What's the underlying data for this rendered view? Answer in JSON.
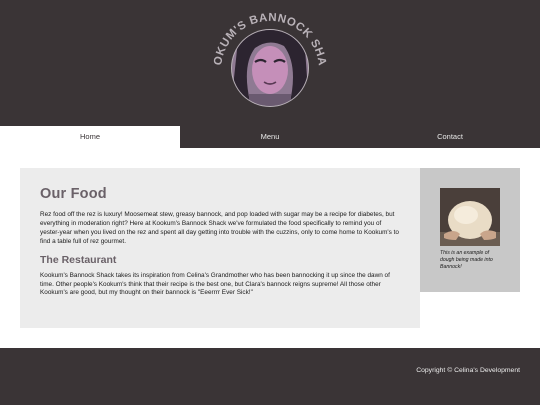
{
  "header": {
    "logo_text": "KOOKUM'S BANNOCK SHACK",
    "logo_icon": "kookum-portrait-logo"
  },
  "nav": {
    "items": [
      {
        "label": "Home",
        "active": true
      },
      {
        "label": "Menu",
        "active": false
      },
      {
        "label": "Contact",
        "active": false
      }
    ]
  },
  "main": {
    "title": "Our Food",
    "intro": "Rez food off the rez is luxury! Moosemeat stew, greasy bannock, and pop loaded with sugar may be a recipe for diabetes, but everything in moderation right? Here at Kookum's Bannock Shack we've formulated the food specifically to remind you of yester-year when you lived on the rez and spent all day getting into trouble with the cuzzins, only to come home to Kookum's to find a table full of rez gourmet.",
    "section_title": "The Restaurant",
    "section_body": "Kookum's Bannock Shack takes its inspiration from Celina's Grandmother who has been bannocking it up since the dawn of time. Other people's Kookum's think that their recipe is the best one, but Clara's bannock reigns supreme! All those other Kookum's are good, but my thought on their bannock is \"Eeerrrr Ever Sick!\""
  },
  "sidebar": {
    "image_icon": "dough-photo",
    "caption": "This is an example of dough being made into Bannock!"
  },
  "footer": {
    "copyright": "Copyright © Celina's Development"
  },
  "colors": {
    "dark": "#3a3436",
    "panel": "#ececec",
    "side_panel": "#c8c8c8",
    "heading": "#6a6168"
  }
}
